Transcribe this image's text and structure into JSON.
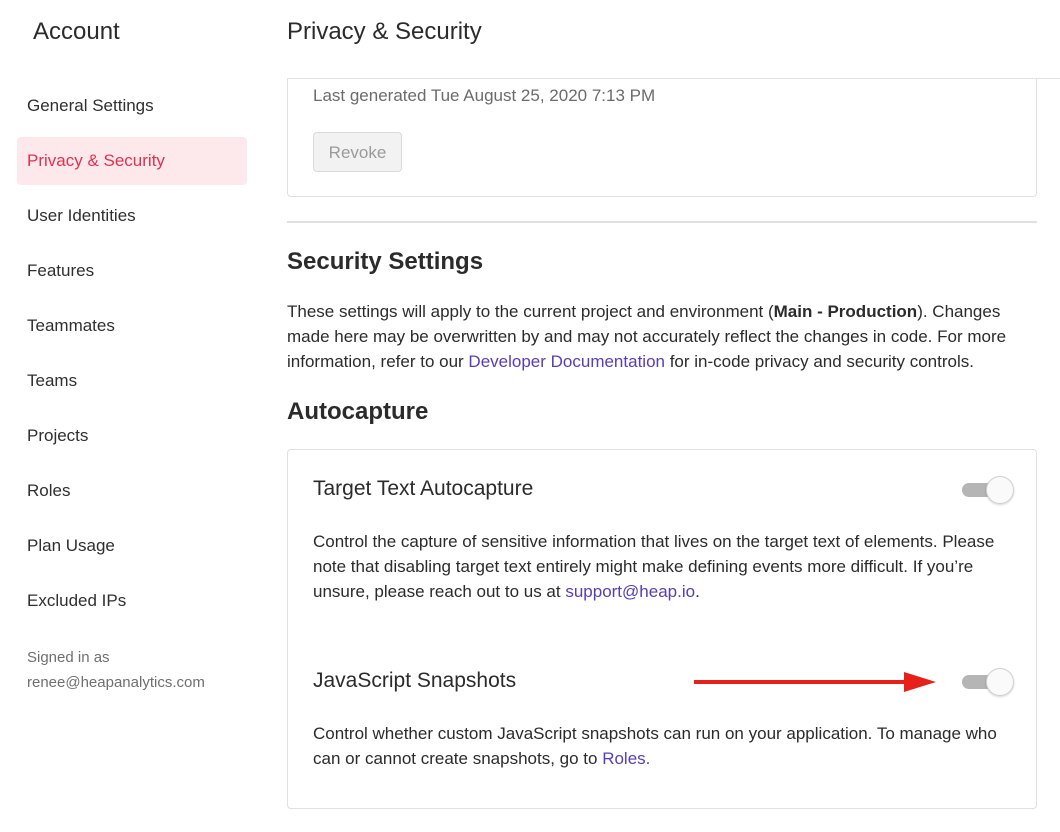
{
  "sidebar": {
    "title": "Account",
    "items": [
      {
        "label": "General Settings"
      },
      {
        "label": "Privacy & Security"
      },
      {
        "label": "User Identities"
      },
      {
        "label": "Features"
      },
      {
        "label": "Teammates"
      },
      {
        "label": "Teams"
      },
      {
        "label": "Projects"
      },
      {
        "label": "Roles"
      },
      {
        "label": "Plan Usage"
      },
      {
        "label": "Excluded IPs"
      }
    ],
    "active_item": "Privacy & Security",
    "signed_in_label": "Signed in as",
    "signed_in_email": "renee@heapanalytics.com"
  },
  "header": {
    "title": "Privacy & Security"
  },
  "token_card": {
    "last_generated": "Last generated Tue August 25, 2020 7:13 PM",
    "revoke_label": "Revoke"
  },
  "security": {
    "title": "Security Settings",
    "desc_prefix": "These settings will apply to the current project and environment (",
    "desc_bold": "Main - Production",
    "desc_middle": "). Changes made here may be overwritten by and may not accurately reflect the changes in code. For more information, refer to our ",
    "desc_link": "Developer Documentation",
    "desc_suffix": " for in-code privacy and security controls."
  },
  "autocapture": {
    "title": "Autocapture",
    "target_text": {
      "title": "Target Text Autocapture",
      "desc": "Control the capture of sensitive information that lives on the target text of elements. Please note that disabling target text entirely might make defining events more difficult. If you’re unsure, please reach out to us at ",
      "link": "support@heap.io",
      "desc_end": ".",
      "enabled": true
    },
    "js_snapshots": {
      "title": "JavaScript Snapshots",
      "desc": "Control whether custom JavaScript snapshots can run on your application. To manage who can or cannot create snapshots, go to ",
      "link": "Roles.",
      "enabled": true
    }
  },
  "colors": {
    "active_nav_bg": "#fde8ec",
    "active_nav_text": "#e0324f",
    "link": "#5a3db0",
    "annotation_arrow": "#e8201a"
  }
}
